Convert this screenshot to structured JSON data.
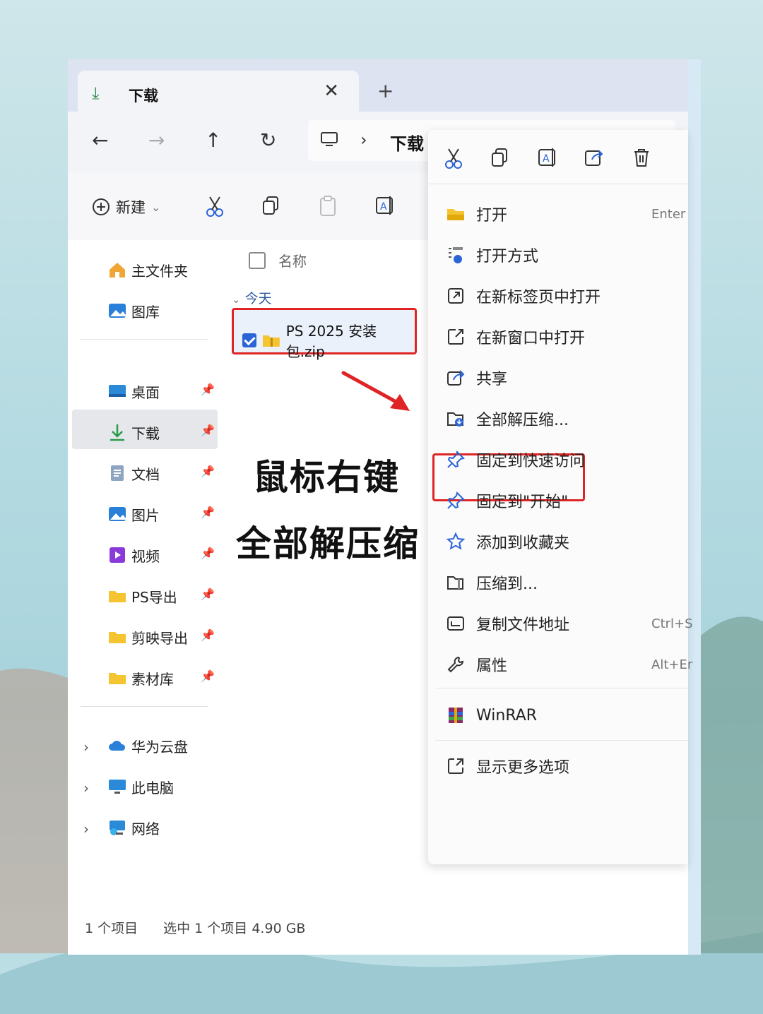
{
  "window": {
    "tab_title": "下载",
    "tab_close": "✕",
    "new_tab": "+",
    "address": {
      "separator": "›",
      "current": "下载"
    }
  },
  "nav": {
    "back": "←",
    "forward": "→",
    "up": "↑",
    "refresh": "↻"
  },
  "toolbar": {
    "new_label": "新建",
    "new_chevron": "⌄"
  },
  "sidebar": {
    "home": "主文件夹",
    "gallery": "图库",
    "pinned": [
      {
        "label": "桌面"
      },
      {
        "label": "下载"
      },
      {
        "label": "文档"
      },
      {
        "label": "图片"
      },
      {
        "label": "视频"
      },
      {
        "label": "PS导出"
      },
      {
        "label": "剪映导出"
      },
      {
        "label": "素材库"
      }
    ],
    "locations": [
      {
        "label": "华为云盘"
      },
      {
        "label": "此电脑"
      },
      {
        "label": "网络"
      }
    ],
    "chevron": "›",
    "pin": "📌"
  },
  "files": {
    "column_name": "名称",
    "group_label": "今天",
    "group_chevron": "⌄",
    "selected_file": "PS 2025 安装包.zip"
  },
  "overlay": {
    "line1": "鼠标右键",
    "line2": "全部解压缩"
  },
  "status": {
    "count": "1 个项目",
    "selected": "选中 1 个项目 4.90 GB"
  },
  "context_menu": {
    "items": [
      {
        "label": "打开",
        "shortcut": "Enter"
      },
      {
        "label": "打开方式",
        "shortcut": ""
      },
      {
        "label": "在新标签页中打开",
        "shortcut": ""
      },
      {
        "label": "在新窗口中打开",
        "shortcut": ""
      },
      {
        "label": "共享",
        "shortcut": ""
      },
      {
        "label": "全部解压缩...",
        "shortcut": ""
      },
      {
        "label": "固定到快速访问",
        "shortcut": ""
      },
      {
        "label": "固定到\"开始\"",
        "shortcut": ""
      },
      {
        "label": "添加到收藏夹",
        "shortcut": ""
      },
      {
        "label": "压缩到...",
        "shortcut": ""
      },
      {
        "label": "复制文件地址",
        "shortcut": "Ctrl+S"
      },
      {
        "label": "属性",
        "shortcut": "Alt+Er"
      }
    ],
    "winrar": "WinRAR",
    "more_options": "显示更多选项"
  },
  "colors": {
    "highlight_red": "#e02424",
    "accent_blue": "#2a64d6",
    "folder_yellow": "#f5c431"
  }
}
